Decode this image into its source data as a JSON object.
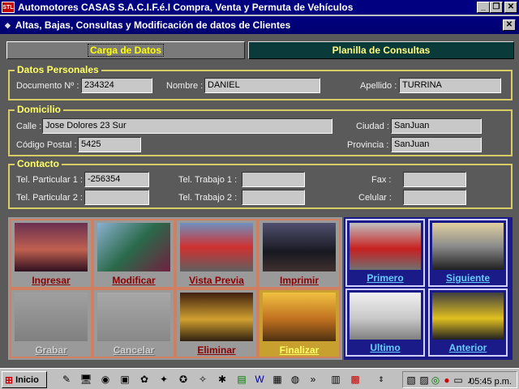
{
  "app": {
    "title": "Automotores CASAS S.A.C.I.F.é.I Compra, Venta y Permuta de Vehículos",
    "logo_text": "STL",
    "controls": {
      "minimize": "_",
      "restore": "❐",
      "close": "✕"
    }
  },
  "form": {
    "title": "Altas, Bajas, Consultas y Modificación de datos de Clientes",
    "close": "✕"
  },
  "tabs": [
    {
      "label": "Carga de Datos",
      "selected": true
    },
    {
      "label": "Planilla de Consultas",
      "selected": false
    }
  ],
  "datos_personales": {
    "legend": "Datos Personales",
    "documento_label": "Documento Nº :",
    "documento_value": "234324",
    "nombre_label": "Nombre :",
    "nombre_value": "DANIEL",
    "apellido_label": "Apellido :",
    "apellido_value": "TURRINA"
  },
  "domicilio": {
    "legend": "Domicilio",
    "calle_label": "Calle :",
    "calle_value": "Jose Dolores 23 Sur",
    "ciudad_label": "Ciudad :",
    "ciudad_value": "SanJuan",
    "cp_label": "Código Postal :",
    "cp_value": "5425",
    "provincia_label": "Provincia :",
    "provincia_value": "SanJuan"
  },
  "contacto": {
    "legend": "Contacto",
    "tel1_label": "Tel. Particular 1 :",
    "tel1_value": "-256354",
    "tel2_label": "Tel. Particular 2 :",
    "tel2_value": "",
    "trab1_label": "Tel. Trabajo 1 :",
    "trab1_value": "",
    "trab2_label": "Tel. Trabajo 2 :",
    "trab2_value": "",
    "fax_label": "Fax :",
    "fax_value": "",
    "celular_label": "Celular :",
    "celular_value": ""
  },
  "actions": {
    "ingresar": "Ingresar",
    "modificar": "Modificar",
    "vista_previa": "Vista Previa",
    "imprimir": "Imprimir",
    "grabar": "Grabar",
    "cancelar": "Cancelar",
    "eliminar": "Eliminar",
    "finalizar": "Finalizar"
  },
  "navigation": {
    "primero": "Primero",
    "siguiente": "Siguiente",
    "ultimo": "Ultimo",
    "anterior": "Anterior"
  },
  "taskbar": {
    "start_label": "Inicio",
    "clock": "05:45 p.m."
  },
  "colors": {
    "legend": "#ffff66",
    "group_border": "#d8cc66",
    "action_caption": "#8a0000",
    "nav_caption": "#66ccff",
    "nav_panel": "#1a1a88"
  }
}
